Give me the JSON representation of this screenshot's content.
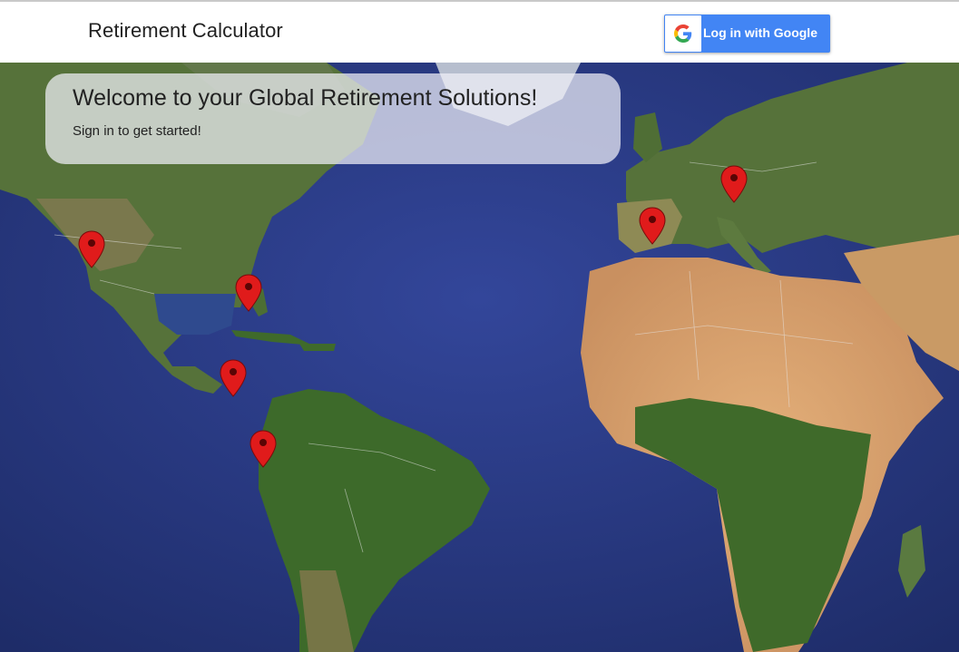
{
  "app": {
    "title": "Retirement Calculator"
  },
  "auth": {
    "google_button_label": "Log in with Google"
  },
  "welcome": {
    "title": "Welcome to your Global Retirement Solutions!",
    "subtitle": "Sign in to get started!"
  },
  "map": {
    "style": "satellite",
    "marker_color": "#e01b1b",
    "markers": [
      {
        "name": "marker-southwest-usa"
      },
      {
        "name": "marker-florida"
      },
      {
        "name": "marker-costa-rica"
      },
      {
        "name": "marker-ecuador"
      },
      {
        "name": "marker-spain"
      },
      {
        "name": "marker-croatia"
      }
    ]
  },
  "colors": {
    "google_blue": "#4285f4",
    "ocean": "#2b3c82",
    "land_green": "#3e6a2c",
    "desert": "#d6a46a"
  }
}
